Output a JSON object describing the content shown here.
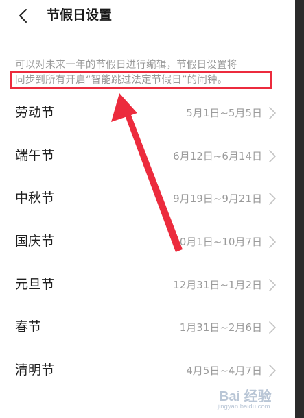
{
  "header": {
    "back_icon": "chevron-left-icon",
    "title": "节假日设置"
  },
  "description": {
    "line1": "可以对未来一年的节假日进行编辑，节假日设置将",
    "line2": "同步到所有开启“智能跳过法定节假日”的闹钟。"
  },
  "annotation": {
    "highlight_color": "#ec2b3d",
    "arrow_color": "#ec2b3d"
  },
  "holidays": [
    {
      "name": "劳动节",
      "range": "5月1日~5月5日"
    },
    {
      "name": "端午节",
      "range": "6月12日~6月14日"
    },
    {
      "name": "中秋节",
      "range": "9月19日~9月21日"
    },
    {
      "name": "国庆节",
      "range": "10月1日~10月7日"
    },
    {
      "name": "元旦节",
      "range": "12月31日~1月2日"
    },
    {
      "name": "春节",
      "range": "1月31日~2月6日"
    },
    {
      "name": "清明节",
      "range": "4月5日~4月7日"
    }
  ],
  "watermark": {
    "brand": "Bai 经验",
    "url": "jingyan.baidu.com"
  }
}
